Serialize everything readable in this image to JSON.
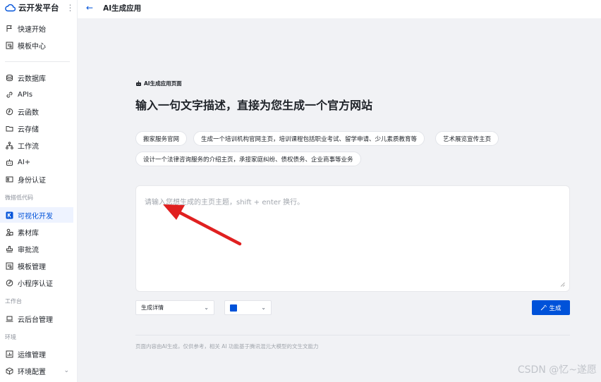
{
  "app": {
    "name": "云开发平台",
    "more_icon": "more-vertical-icon"
  },
  "topbar": {
    "back_icon": "arrow-left-icon",
    "title": "AI生成应用"
  },
  "sidebar": {
    "group1": [
      {
        "label": "快速开始",
        "icon": "flag-icon"
      },
      {
        "label": "模板中心",
        "icon": "template-icon"
      }
    ],
    "group2": [
      {
        "label": "云数据库",
        "icon": "database-icon"
      },
      {
        "label": "APIs",
        "icon": "link-icon"
      },
      {
        "label": "云函数",
        "icon": "function-icon"
      },
      {
        "label": "云存储",
        "icon": "folder-icon"
      },
      {
        "label": "工作流",
        "icon": "workflow-icon"
      },
      {
        "label": "AI+",
        "icon": "robot-icon"
      },
      {
        "label": "身份认证",
        "icon": "id-card-icon"
      }
    ],
    "section_lowcode": "微搭低代码",
    "group3": [
      {
        "label": "可视化开发",
        "icon": "k-logo-icon",
        "active": true
      },
      {
        "label": "素材库",
        "icon": "assets-icon"
      },
      {
        "label": "审批流",
        "icon": "stamp-icon"
      },
      {
        "label": "模板管理",
        "icon": "template-icon"
      },
      {
        "label": "小程序认证",
        "icon": "miniprogram-icon"
      }
    ],
    "section_workbench": "工作台",
    "group4": [
      {
        "label": "云后台管理",
        "icon": "laptop-icon"
      }
    ],
    "section_env": "环境",
    "group5": [
      {
        "label": "运维管理",
        "icon": "chart-icon"
      },
      {
        "label": "环境配置",
        "icon": "cube-icon"
      }
    ]
  },
  "main": {
    "eyebrow": "AI生成应用页面",
    "headline": "输入一句文字描述，直接为您生成一个官方网站",
    "chips": [
      "搬家服务官网",
      "生成一个培训机构官网主页，培训课程包括职业考试、留学申请、少儿素质教育等",
      "艺术展览宣传主页",
      "设计一个法律咨询服务的介绍主页，承接家庭纠纷、债权债务、企业商事等业务"
    ],
    "prompt": {
      "value": "",
      "placeholder": "请输入您想生成的主页主题，shift + enter 换行。"
    },
    "detail_select": "生成详情",
    "color_select": {
      "value": "#0052d9"
    },
    "generate_button": "生成",
    "disclaimer": "页面内容由AI生成，仅供参考，相关 AI 功能基于腾讯混元大模型的文生文能力"
  },
  "watermark": "CSDN @忆~遂愿",
  "colors": {
    "accent": "#0052d9",
    "annotation_arrow": "#e02020",
    "background": "#f1f2f5"
  }
}
